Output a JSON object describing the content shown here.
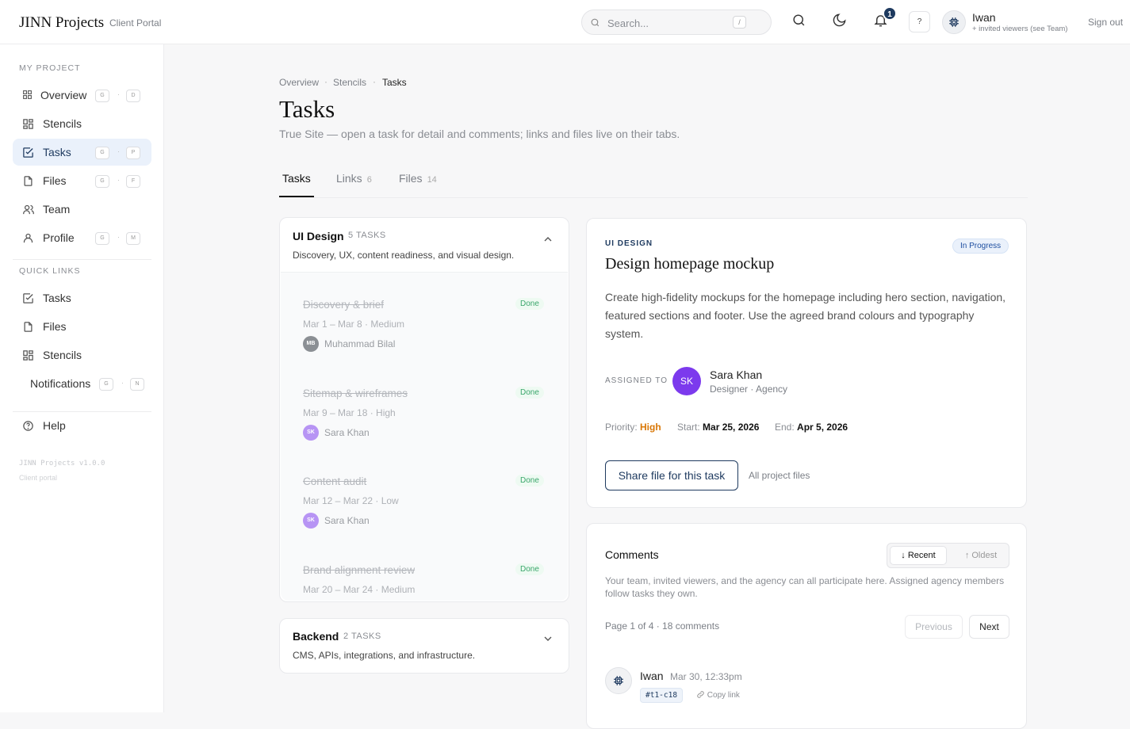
{
  "header": {
    "app_title": "JINN Projects",
    "app_subtitle": "Client Portal",
    "search_placeholder": "Search...",
    "search_shortcut": "/",
    "notification_count": "1",
    "help_label": "?",
    "user_name": "Iwan",
    "user_subtitle": "+ invited viewers (see Team)",
    "sign_out": "Sign out"
  },
  "sidebar": {
    "section_project": "MY PROJECT",
    "project_items": [
      {
        "label": "Overview",
        "icon": "grid-icon",
        "keys": [
          "G",
          "D"
        ]
      },
      {
        "label": "Stencils",
        "icon": "grid-icon",
        "keys": []
      },
      {
        "label": "Tasks",
        "icon": "check-square-icon",
        "keys": [
          "G",
          "P"
        ],
        "active": true
      },
      {
        "label": "Files",
        "icon": "file-icon",
        "keys": [
          "G",
          "F"
        ]
      },
      {
        "label": "Team",
        "icon": "users-icon",
        "keys": []
      },
      {
        "label": "Profile",
        "icon": "user-icon",
        "keys": [
          "G",
          "M"
        ]
      }
    ],
    "section_quick": "QUICK LINKS",
    "quick_items": [
      {
        "label": "Tasks",
        "icon": "check-square-icon"
      },
      {
        "label": "Files",
        "icon": "file-icon"
      },
      {
        "label": "Stencils",
        "icon": "grid-icon"
      },
      {
        "label": "Notifications",
        "keys": [
          "G",
          "N"
        ]
      }
    ],
    "help": "Help",
    "version": "JINN Projects v1.0.0",
    "version_sub": "Client portal"
  },
  "breadcrumb": [
    "Overview",
    "Stencils",
    "Tasks"
  ],
  "page": {
    "title": "Tasks",
    "description": "True Site — open a task for detail and comments; links and files live on their tabs."
  },
  "tabs": [
    {
      "label": "Tasks",
      "count": ""
    },
    {
      "label": "Links",
      "count": "6"
    },
    {
      "label": "Files",
      "count": "14"
    }
  ],
  "groups": [
    {
      "title": "UI Design",
      "count": "5 TASKS",
      "description": "Discovery, UX, content readiness, and visual design.",
      "expanded": true,
      "tasks": [
        {
          "title": "Discovery & brief",
          "status": "Done",
          "meta": "Mar 1 – Mar 8 · Medium",
          "initials": "MB",
          "assignee": "Muhammad Bilal",
          "avatar_color": "#8b8f94"
        },
        {
          "title": "Sitemap & wireframes",
          "status": "Done",
          "meta": "Mar 9 – Mar 18 · High",
          "initials": "SK",
          "assignee": "Sara Khan",
          "avatar_color": "#b794f4"
        },
        {
          "title": "Content audit",
          "status": "Done",
          "meta": "Mar 12 – Mar 22 · Low",
          "initials": "SK",
          "assignee": "Sara Khan",
          "avatar_color": "#b794f4"
        },
        {
          "title": "Brand alignment review",
          "status": "Done",
          "meta": "Mar 20 – Mar 24 · Medium",
          "initials": "",
          "assignee": "",
          "avatar_color": "#b794f4"
        }
      ]
    },
    {
      "title": "Backend",
      "count": "2 TASKS",
      "description": "CMS, APIs, integrations, and infrastructure.",
      "expanded": false
    }
  ],
  "detail": {
    "category": "UI DESIGN",
    "status": "In Progress",
    "title": "Design homepage mockup",
    "description": "Create high-fidelity mockups for the homepage including hero section, navigation, featured sections and footer. Use the agreed brand colours and typography system.",
    "assigned_label": "ASSIGNED TO",
    "assignee_initials": "SK",
    "assignee_name": "Sara Khan",
    "assignee_role": "Designer · Agency",
    "priority_label": "Priority:",
    "priority": "High",
    "start_label": "Start:",
    "start": "Mar 25, 2026",
    "end_label": "End:",
    "end": "Apr 5, 2026",
    "share_button": "Share file for this task",
    "all_files": "All project files"
  },
  "comments": {
    "title": "Comments",
    "sort_recent": "Recent",
    "sort_oldest": "Oldest",
    "description": "Your team, invited viewers, and the agency can all participate here. Assigned agency members follow tasks they own.",
    "pager": "Page 1 of 4 · 18 comments",
    "prev": "Previous",
    "next": "Next",
    "items": [
      {
        "author": "Iwan",
        "time": "Mar 30, 12:33pm",
        "id": "#t1-c18",
        "copy_link": "Copy link"
      }
    ]
  },
  "colors": {
    "accent": "#1e3a5f",
    "active_bg": "#eaf1fb",
    "assignee": "#7c3aed",
    "priority_high": "#d97706",
    "done": "#3aa66b"
  }
}
